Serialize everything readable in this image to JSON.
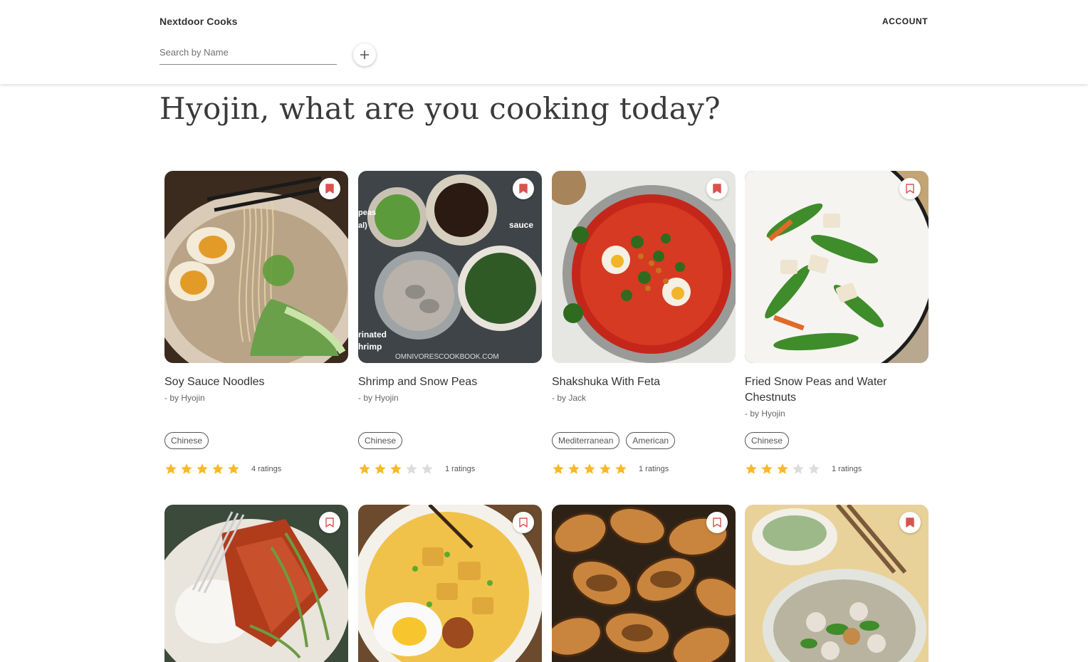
{
  "header": {
    "brand": "Nextdoor Cooks",
    "account": "ACCOUNT",
    "search_placeholder": "Search by Name",
    "add_icon": "plus-icon"
  },
  "greeting": "Hyojin, what are you cooking today?",
  "colors": {
    "accent": "#d9534f",
    "star_filled": "#f9b928",
    "star_empty": "#dcdcdc"
  },
  "recipes": [
    {
      "title": "Soy Sauce Noodles",
      "author": "- by Hyojin",
      "tags": [
        "Chinese"
      ],
      "stars": 5,
      "ratings": "4 ratings",
      "bookmarked": true
    },
    {
      "title": "Shrimp and Snow Peas",
      "author": "- by Hyojin",
      "tags": [
        "Chinese"
      ],
      "stars": 3,
      "ratings": "1 ratings",
      "bookmarked": true,
      "image_text": [
        "peas",
        "al)",
        "sauce",
        "rinated",
        "hrimp",
        "OMNIVORESCOOKBOOK.COM"
      ]
    },
    {
      "title": "Shakshuka With Feta",
      "author": "- by Jack",
      "tags": [
        "Mediterranean",
        "American"
      ],
      "stars": 5,
      "ratings": "1 ratings",
      "bookmarked": true
    },
    {
      "title": "Fried Snow Peas and Water Chestnuts",
      "author": "- by Hyojin",
      "tags": [
        "Chinese"
      ],
      "stars": 3,
      "ratings": "1 ratings",
      "bookmarked": false
    },
    {
      "bookmarked": false
    },
    {
      "bookmarked": false
    },
    {
      "bookmarked": false
    },
    {
      "bookmarked": true
    }
  ]
}
